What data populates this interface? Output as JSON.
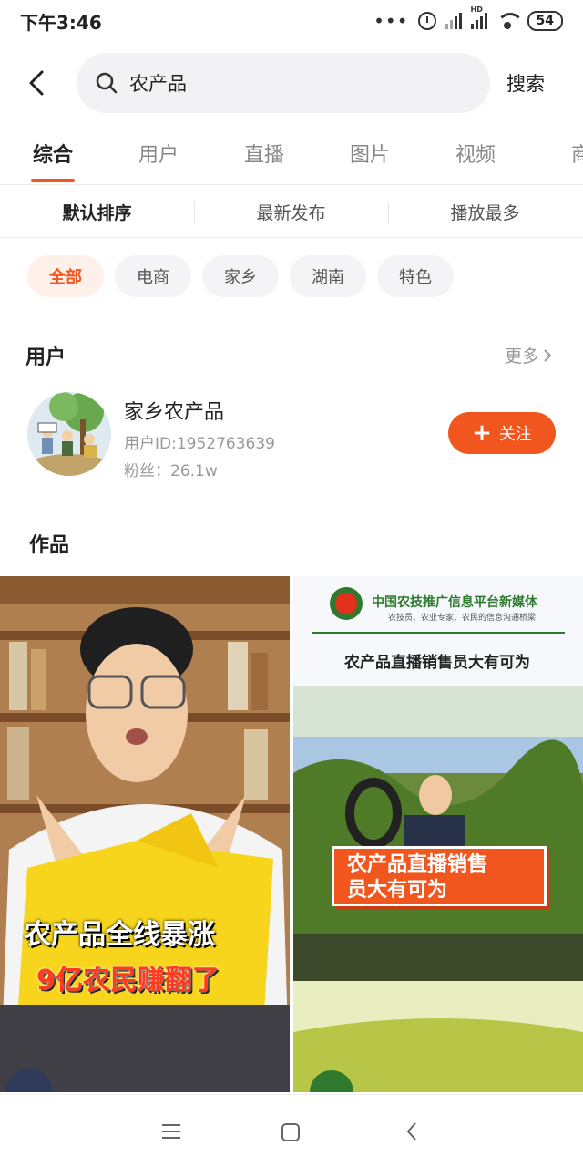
{
  "status": {
    "time": "下午3:46",
    "dots": "•••",
    "hd": "HD",
    "battery": "54"
  },
  "search": {
    "query": "农产品",
    "button": "搜索"
  },
  "tabs": [
    {
      "label": "综合",
      "active": true
    },
    {
      "label": "用户",
      "active": false
    },
    {
      "label": "直播",
      "active": false
    },
    {
      "label": "图片",
      "active": false
    },
    {
      "label": "视频",
      "active": false
    },
    {
      "label": "商",
      "active": false
    }
  ],
  "sort": [
    {
      "label": "默认排序",
      "active": true
    },
    {
      "label": "最新发布",
      "active": false
    },
    {
      "label": "播放最多",
      "active": false
    }
  ],
  "chips": [
    {
      "label": "全部",
      "active": true
    },
    {
      "label": "电商",
      "active": false
    },
    {
      "label": "家乡",
      "active": false
    },
    {
      "label": "湖南",
      "active": false
    },
    {
      "label": "特色",
      "active": false
    }
  ],
  "users_section": {
    "title": "用户",
    "more": "更多"
  },
  "user": {
    "name": "家乡农产品",
    "id": "用户ID:1952763639",
    "fans": "粉丝：26.1w",
    "follow": "关注"
  },
  "works_section": {
    "title": "作品"
  },
  "videos": {
    "left": {
      "line1": "农产品全线暴涨",
      "line2": "9亿农民赚翻了"
    },
    "right": {
      "org": "中国农技推广信息平台新媒体",
      "org_sub": "农技员、农业专家、农民的信息沟通桥梁",
      "headline": "农产品直播销售员大有可为",
      "overlay_line1": "农产品直播销售",
      "overlay_line2": "员大有可为"
    }
  },
  "colors": {
    "accent": "#f2561f"
  }
}
